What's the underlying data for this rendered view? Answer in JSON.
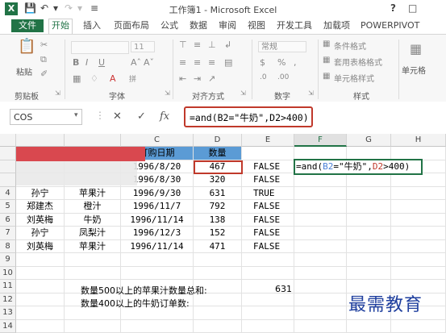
{
  "titlebar": {
    "title": "工作簿1 - Microsoft Excel",
    "logo": "X",
    "help": "?"
  },
  "tabs": [
    "文件",
    "开始",
    "插入",
    "页面布局",
    "公式",
    "数据",
    "审阅",
    "视图",
    "开发工具",
    "加载项",
    "POWERPIVOT"
  ],
  "ribbon": {
    "paste": "粘贴",
    "clipboard": "剪贴板",
    "font": "字体",
    "font_size": "11",
    "font_bold": "B",
    "font_italic": "I",
    "font_underline": "U",
    "alignment": "对齐方式",
    "number_format": "常规",
    "number": "数字",
    "cond_format": "条件格式",
    "table_format": "套用表格格式",
    "cell_style": "单元格样式",
    "styles": "样式",
    "cells": "单元格"
  },
  "formula_bar": {
    "name_box": "COS",
    "fx": "fx",
    "formula": "=and(B2=\"牛奶\",D2>400)"
  },
  "columns": [
    "C",
    "D",
    "E",
    "F",
    "G",
    "H"
  ],
  "rows": [
    {
      "n": "",
      "a": "",
      "b": "",
      "c": "订购日期",
      "d": "数量",
      "e": ""
    },
    {
      "n": "",
      "a": "",
      "b": "",
      "c": "1996/8/20",
      "d": "467",
      "e": "FALSE"
    },
    {
      "n": "",
      "a": "",
      "b": "",
      "c": "1996/8/30",
      "d": "320",
      "e": "FALSE"
    },
    {
      "n": "4",
      "a": "孙宁",
      "b": "苹果汁",
      "c": "1996/9/30",
      "d": "631",
      "e": "TRUE"
    },
    {
      "n": "5",
      "a": "郑建杰",
      "b": "橙汁",
      "c": "1996/11/7",
      "d": "792",
      "e": "FALSE"
    },
    {
      "n": "6",
      "a": "刘英梅",
      "b": "牛奶",
      "c": "1996/11/14",
      "d": "138",
      "e": "FALSE"
    },
    {
      "n": "7",
      "a": "孙宁",
      "b": "凤梨汁",
      "c": "1996/12/3",
      "d": "152",
      "e": "FALSE"
    },
    {
      "n": "8",
      "a": "刘英梅",
      "b": "苹果汁",
      "c": "1996/11/14",
      "d": "471",
      "e": "FALSE"
    },
    {
      "n": "9",
      "a": "",
      "b": "",
      "c": "",
      "d": "",
      "e": ""
    },
    {
      "n": "10",
      "a": "",
      "b": "",
      "c": "",
      "d": "",
      "e": ""
    },
    {
      "n": "11",
      "a": "",
      "b": "",
      "c": "",
      "d": "",
      "e": ""
    },
    {
      "n": "12",
      "a": "",
      "b": "",
      "c": "",
      "d": "",
      "e": ""
    },
    {
      "n": "13",
      "a": "",
      "b": "",
      "c": "",
      "d": "",
      "e": ""
    },
    {
      "n": "14",
      "a": "",
      "b": "",
      "c": "",
      "d": "",
      "e": ""
    }
  ],
  "edit_cell": {
    "prefix": "=and(",
    "ref1": "B2",
    "mid": "=\"牛奶\",",
    "ref2": "D2",
    "suffix": ">400)"
  },
  "notes": {
    "line1": "数量500以上的苹果汁数量总和:",
    "value1": "631",
    "line2": "数量400以上的牛奶订单数:"
  },
  "watermark": "最需教育",
  "colors": {
    "excel_green": "#217346",
    "header_blue": "#5b9bd5",
    "highlight_red": "#c0392b",
    "watermark": "#1f3f9e"
  }
}
